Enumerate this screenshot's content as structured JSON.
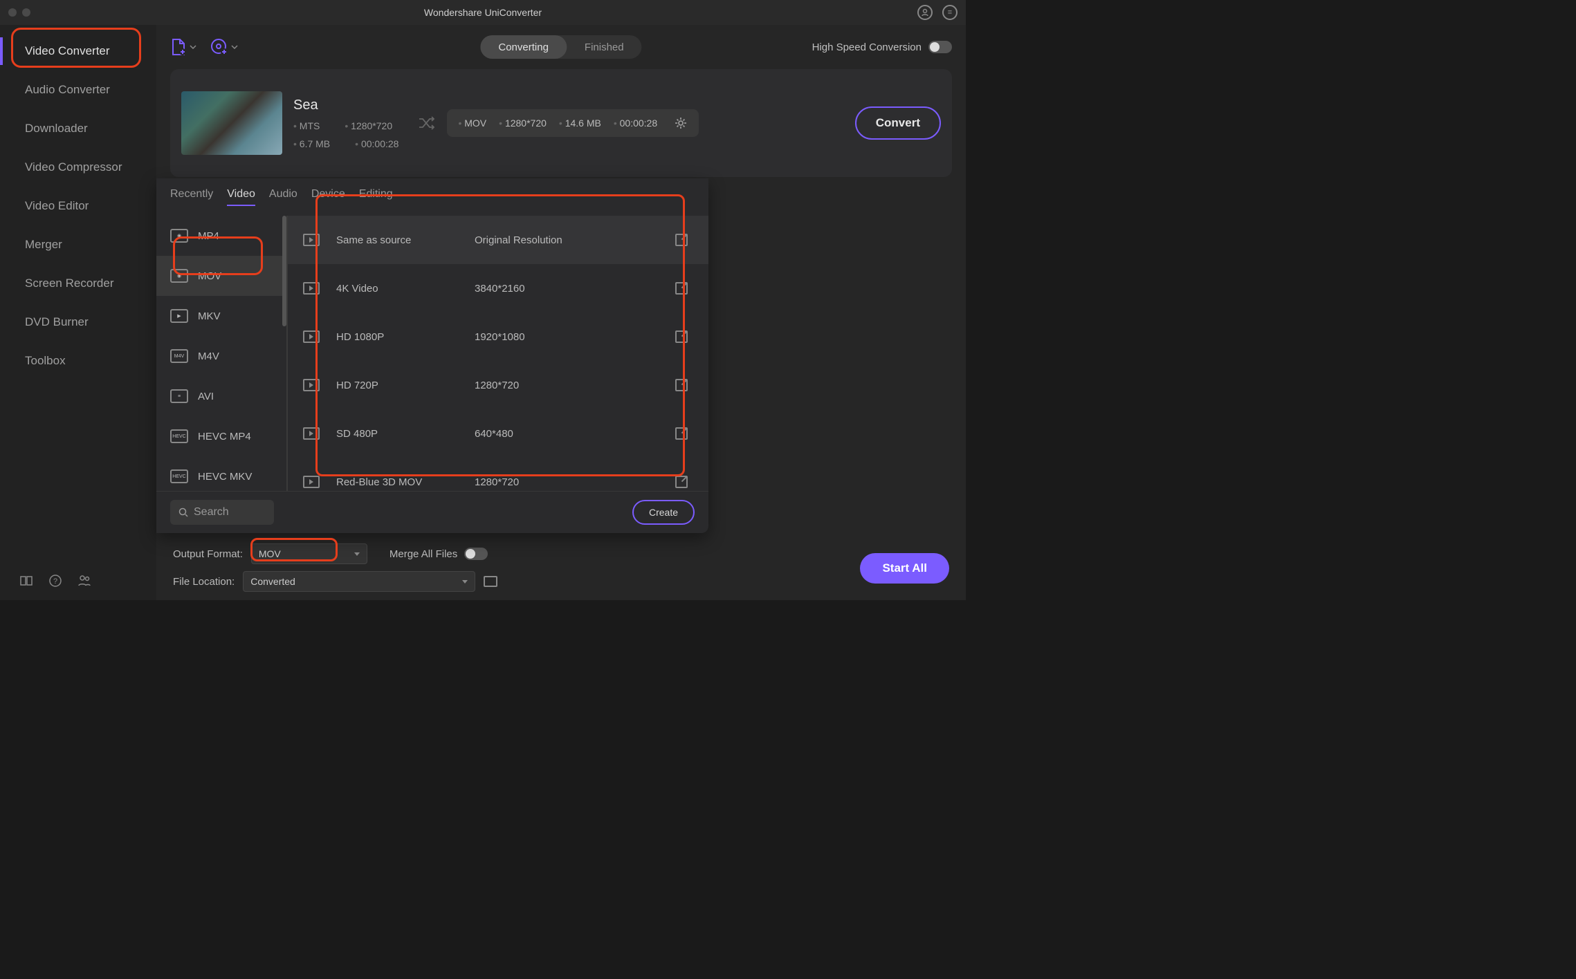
{
  "title": "Wondershare UniConverter",
  "sidebar": {
    "items": [
      {
        "label": "Video Converter",
        "active": true
      },
      {
        "label": "Audio Converter"
      },
      {
        "label": "Downloader"
      },
      {
        "label": "Video Compressor"
      },
      {
        "label": "Video Editor"
      },
      {
        "label": "Merger"
      },
      {
        "label": "Screen Recorder"
      },
      {
        "label": "DVD Burner"
      },
      {
        "label": "Toolbox"
      }
    ]
  },
  "toolbar": {
    "tabs": {
      "converting": "Converting",
      "finished": "Finished"
    },
    "hsc_label": "High Speed Conversion"
  },
  "file": {
    "name": "Sea",
    "src": {
      "format": "MTS",
      "dim": "1280*720",
      "size": "6.7 MB",
      "dur": "00:00:28"
    },
    "out": {
      "format": "MOV",
      "dim": "1280*720",
      "size": "14.6 MB",
      "dur": "00:00:28"
    },
    "convert_label": "Convert"
  },
  "format_popup": {
    "tabs": [
      "Recently",
      "Video",
      "Audio",
      "Device",
      "Editing"
    ],
    "active_tab": "Video",
    "formats": [
      "MP4",
      "MOV",
      "MKV",
      "M4V",
      "AVI",
      "HEVC MP4",
      "HEVC MKV"
    ],
    "active_format": "MOV",
    "resolutions": [
      {
        "name": "Same as source",
        "dim": "Original Resolution"
      },
      {
        "name": "4K Video",
        "dim": "3840*2160"
      },
      {
        "name": "HD 1080P",
        "dim": "1920*1080"
      },
      {
        "name": "HD 720P",
        "dim": "1280*720"
      },
      {
        "name": "SD 480P",
        "dim": "640*480"
      },
      {
        "name": "Red-Blue 3D MOV",
        "dim": "1280*720"
      }
    ],
    "search_placeholder": "Search",
    "create_label": "Create"
  },
  "bottom": {
    "output_format_label": "Output Format:",
    "output_format_value": "MOV",
    "merge_label": "Merge All Files",
    "file_location_label": "File Location:",
    "file_location_value": "Converted",
    "start_all_label": "Start All"
  }
}
